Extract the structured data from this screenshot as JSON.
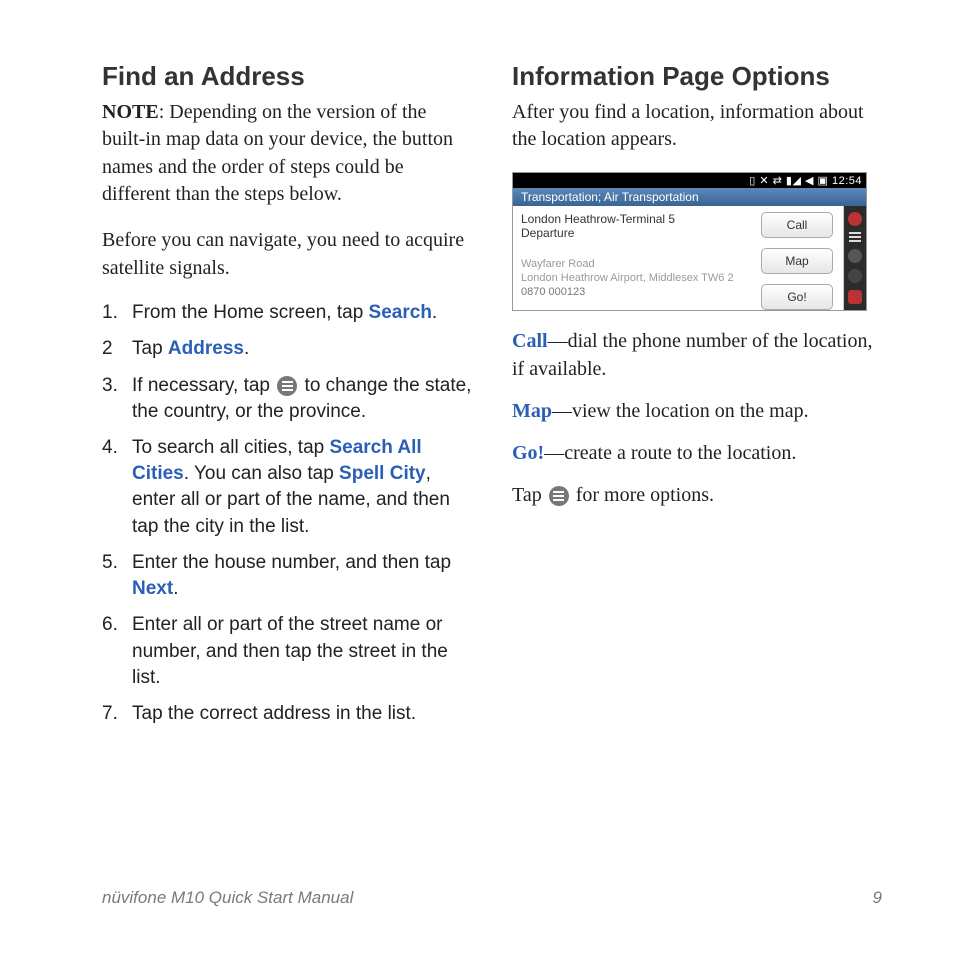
{
  "left": {
    "heading": "Find an Address",
    "note_lead": "NOTE",
    "note_body": ": Depending on the version of the built-in map data on your device, the button names and the order of steps could be different than the steps below.",
    "para2": "Before you can navigate, you need to acquire satellite signals.",
    "steps": {
      "s1_a": "From the Home screen, tap ",
      "s1_kw": "Search",
      "s1_b": ".",
      "s2_a": "Tap ",
      "s2_kw": "Address",
      "s2_b": ".",
      "s3_a": "If necessary, tap ",
      "s3_b": " to change the state, the country, or the province.",
      "s4_a": "To search all cities, tap ",
      "s4_kw1": "Search All Cities",
      "s4_b": ". You can also tap ",
      "s4_kw2": "Spell City",
      "s4_c": ", enter all or part of the name, and then tap the city in the list.",
      "s5_a": "Enter the house number, and then tap ",
      "s5_kw": "Next",
      "s5_b": ".",
      "s6": "Enter all or part of the street name or number, and then tap the street in the list.",
      "s7": "Tap the correct address in the list."
    }
  },
  "right": {
    "heading": "Information Page Options",
    "intro": "After you find a location, information about the location appears.",
    "shot": {
      "status": "12:54",
      "breadcrumb": "Transportation; Air Transportation",
      "line1": "London Heathrow-Terminal 5",
      "line2": "Departure",
      "sub1": "Wayfarer Road",
      "sub2": "London Heathrow Airport, Middlesex TW6 2",
      "phone": "0870 000123",
      "btn_call": "Call",
      "btn_map": "Map",
      "btn_go": "Go!"
    },
    "def_call_term": "Call",
    "def_call_body": "—dial the phone number of the location, if available.",
    "def_map_term": "Map",
    "def_map_body": "—view the location on the map.",
    "def_go_term": "Go!",
    "def_go_body": "—create a route to the location.",
    "tap_a": "Tap ",
    "tap_b": " for more options."
  },
  "footer": {
    "title": "nüvifone M10 Quick Start Manual",
    "page": "9"
  }
}
